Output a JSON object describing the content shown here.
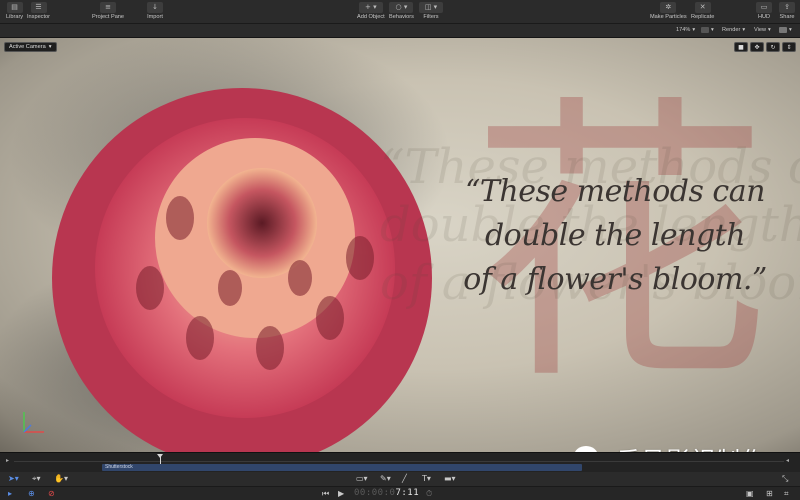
{
  "toolbar": {
    "library": "Library",
    "inspector": "Inspector",
    "project_pane": "Project Pane",
    "import": "Import",
    "add_object": "Add Object",
    "behaviors": "Behaviors",
    "filters": "Filters",
    "make_particles": "Make Particles",
    "replicate": "Replicate",
    "hud": "HUD",
    "share": "Share"
  },
  "viewer_header": {
    "zoom": "174%",
    "render": "Render",
    "view": "View"
  },
  "canvas": {
    "camera": "Active Camera",
    "quote_lines": [
      "“These methods can",
      "double the length",
      "of a flower's bloom.”"
    ],
    "hanzi": "花"
  },
  "timeline": {
    "clip_label": "Shutterstock"
  },
  "transport": {
    "timecode_dim": "00:00:0",
    "timecode_bright": "7:11"
  },
  "watermark": {
    "text": "乐呈影视制作"
  },
  "icons": [
    "library-icon",
    "inspector-icon",
    "project-pane-icon",
    "import-icon",
    "add-object-icon",
    "behaviors-icon",
    "filters-icon",
    "make-particles-icon",
    "replicate-icon",
    "hud-icon",
    "share-icon"
  ]
}
